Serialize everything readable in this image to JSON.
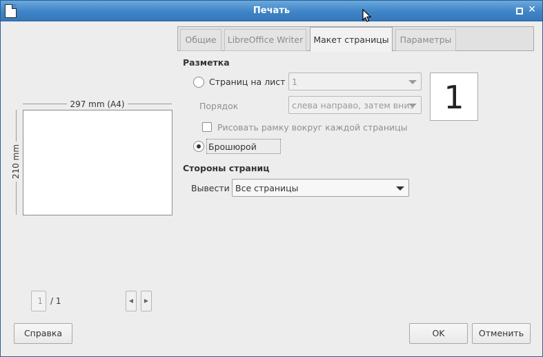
{
  "window": {
    "title": "Печать"
  },
  "preview": {
    "width_label": "297 mm (A4)",
    "height_label": "210 mm",
    "current_page": "1",
    "total_pages": "/ 1"
  },
  "tabs": [
    {
      "label": "Общие",
      "active": false
    },
    {
      "label": "LibreOffice Writer",
      "active": false
    },
    {
      "label": "Макет страницы",
      "active": true
    },
    {
      "label": "Параметры",
      "active": false
    }
  ],
  "layout": {
    "section_title": "Разметка",
    "pages_per_sheet_label": "Страниц на лист",
    "pages_per_sheet_value": "1",
    "order_label": "Порядок",
    "order_value": "слева направо, затем вниз",
    "draw_border_label": "Рисовать рамку вокруг каждой страницы",
    "brochure_label": "Брошюрой",
    "preview_number": "1"
  },
  "sides": {
    "section_title": "Стороны страниц",
    "output_label": "Вывести",
    "output_value": "Все страницы"
  },
  "buttons": {
    "help": "Справка",
    "ok": "OK",
    "cancel": "Отменить"
  },
  "icons": {
    "app": "document-icon",
    "maximize": "maximize-icon",
    "close": "close-icon",
    "prev": "chevron-left-icon",
    "next": "chevron-right-icon"
  }
}
